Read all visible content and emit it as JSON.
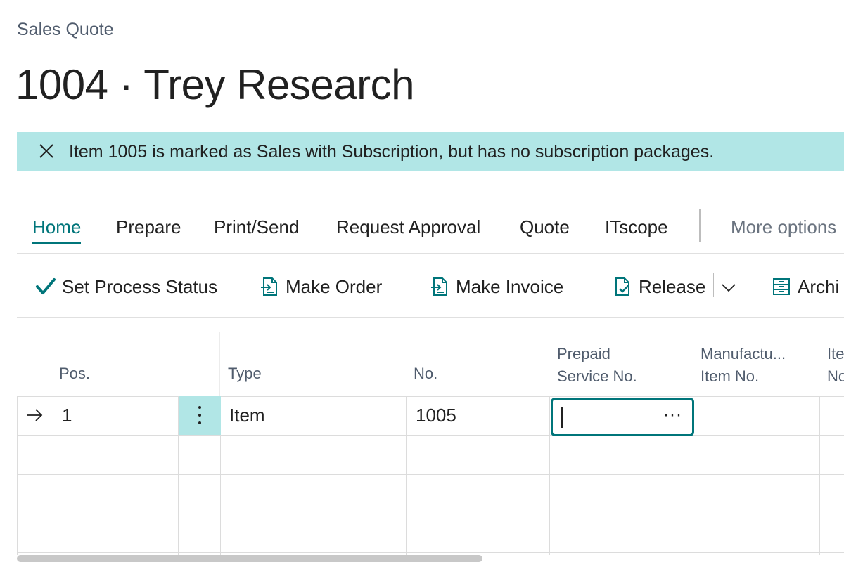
{
  "breadcrumb": "Sales Quote",
  "title": "1004 · Trey Research",
  "notification": {
    "message": "Item 1005 is marked as Sales with Subscription, but has no subscription packages.",
    "close_icon": "close-icon"
  },
  "menu": {
    "tabs": [
      "Home",
      "Prepare",
      "Print/Send",
      "Request Approval",
      "Quote",
      "ITscope"
    ],
    "active": "Home",
    "more": "More options"
  },
  "actions": [
    {
      "label": "Set Process Status",
      "icon": "checkmark-icon"
    },
    {
      "label": "Make Order",
      "icon": "make-order-icon"
    },
    {
      "label": "Make Invoice",
      "icon": "make-invoice-icon"
    },
    {
      "label": "Release",
      "icon": "release-icon"
    },
    {
      "label": "Archi",
      "icon": "archive-icon"
    }
  ],
  "colors": {
    "accent": "#00757a",
    "banner": "#b1e6e6"
  },
  "grid": {
    "columns": [
      {
        "line1": "Pos.",
        "line2": ""
      },
      {
        "line1": "Type",
        "line2": ""
      },
      {
        "line1": "No.",
        "line2": ""
      },
      {
        "line1": "Prepaid",
        "line2": "Service No."
      },
      {
        "line1": "Manufactu...",
        "line2": "Item No."
      },
      {
        "line1": "Ite",
        "line2": "No"
      }
    ],
    "rows": [
      {
        "pos": "1",
        "type": "Item",
        "no": "1005",
        "prepaid_service_no": "",
        "manufacturer_item_no": "",
        "item_no": ""
      },
      {
        "pos": "",
        "type": "",
        "no": "",
        "prepaid_service_no": "",
        "manufacturer_item_no": "",
        "item_no": ""
      },
      {
        "pos": "",
        "type": "",
        "no": "",
        "prepaid_service_no": "",
        "manufacturer_item_no": "",
        "item_no": ""
      },
      {
        "pos": "",
        "type": "",
        "no": "",
        "prepaid_service_no": "",
        "manufacturer_item_no": "",
        "item_no": ""
      }
    ],
    "lookup_dots": "···"
  }
}
